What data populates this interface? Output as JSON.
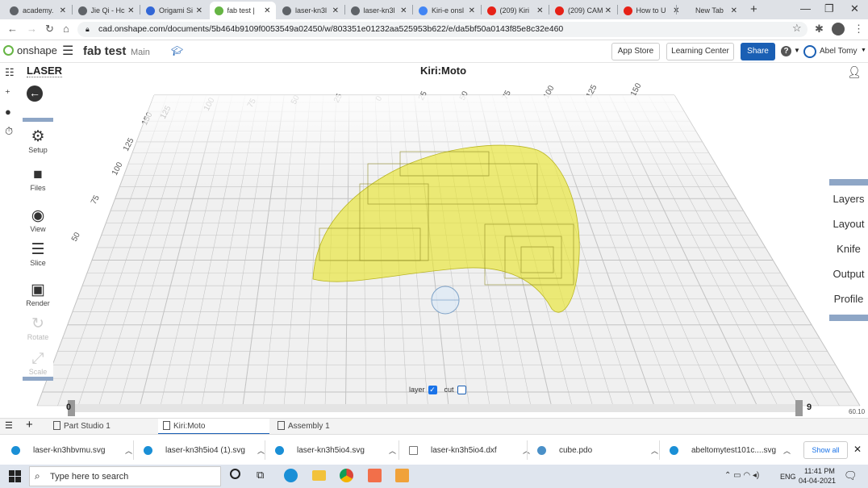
{
  "browser": {
    "tabs": [
      {
        "label": "academy.",
        "color": "#5f6368",
        "active": false
      },
      {
        "label": "Jie Qi - Hc",
        "color": "#5f6368",
        "active": false
      },
      {
        "label": "Origami Si",
        "color": "#3367d6",
        "active": false
      },
      {
        "label": "fab test | ",
        "color": "#66b544",
        "active": true
      },
      {
        "label": "laser-kn3l",
        "color": "#5f6368",
        "active": false
      },
      {
        "label": "laser-kn3l",
        "color": "#5f6368",
        "active": false
      },
      {
        "label": "Kiri-e onsl",
        "color": "#4285f4",
        "active": false
      },
      {
        "label": "(209) Kiri",
        "color": "#e62117",
        "active": false
      },
      {
        "label": "(209) CAM",
        "color": "#e62117",
        "active": false
      },
      {
        "label": "How to U",
        "color": "#e62117",
        "active": false
      },
      {
        "label": "New Tab",
        "color": "#dee1e6",
        "active": false
      }
    ],
    "new_tab_symbol": "+",
    "url": "cad.onshape.com/documents/5b464b9109f0053549a02450/w/803351e01232aa525953b622/e/da5bf50a0143f85e8c32e460"
  },
  "app": {
    "logo_text": "onshape",
    "doc_title": "fab test",
    "branch": "Main",
    "buttons": {
      "app_store": "App Store",
      "learning": "Learning Center",
      "share": "Share"
    },
    "user": "Abel Tomy"
  },
  "kiri": {
    "mode": "LASER",
    "title": "Kiri:Moto",
    "tools": [
      {
        "name": "setup",
        "label": "Setup",
        "icon": "⚙",
        "enabled": true
      },
      {
        "name": "files",
        "label": "Files",
        "icon": "■",
        "enabled": true
      },
      {
        "name": "view",
        "label": "View",
        "icon": "◉",
        "enabled": true
      },
      {
        "name": "slice",
        "label": "Slice",
        "icon": "☰",
        "enabled": true
      },
      {
        "name": "render",
        "label": "Render",
        "icon": "▣",
        "enabled": true
      },
      {
        "name": "rotate",
        "label": "Rotate",
        "icon": "↻",
        "enabled": false
      },
      {
        "name": "scale",
        "label": "Scale",
        "icon": "⤢",
        "enabled": false
      }
    ],
    "right_menu": [
      "Layers",
      "Layout",
      "Knife",
      "Output",
      "Profile"
    ],
    "grid_labels": [
      "50",
      "75",
      "100",
      "125",
      "150",
      "125",
      "100",
      "75",
      "50",
      "25",
      "0",
      "25",
      "50",
      "75",
      "100",
      "125",
      "150"
    ],
    "layer_label": "layer",
    "layer_checked": true,
    "cut_label": "cut",
    "cut_checked": false,
    "slider_min": "0",
    "slider_max": "9",
    "corner_value": "60.10",
    "accent": "#8ea6c6",
    "shape_color": "#e8e52a"
  },
  "bottom_tabs": [
    {
      "label": "Part Studio 1",
      "active": false
    },
    {
      "label": "Kiri:Moto",
      "active": true
    },
    {
      "label": "Assembly 1",
      "active": false
    }
  ],
  "downloads": [
    {
      "name": "laser-kn3hbvmu.svg",
      "icon": "edge-icon"
    },
    {
      "name": "laser-kn3h5io4 (1).svg",
      "icon": "edge-icon"
    },
    {
      "name": "laser-kn3h5io4.svg",
      "icon": "edge-icon"
    },
    {
      "name": "laser-kn3h5io4.dxf",
      "icon": "file-icon"
    },
    {
      "name": "cube.pdo",
      "icon": "pdo-icon"
    },
    {
      "name": "abeltomytest101c....svg",
      "icon": "edge-icon"
    }
  ],
  "downloads_show_all": "Show all",
  "taskbar": {
    "search_placeholder": "Type here to search",
    "lang": "ENG",
    "time": "11:41 PM",
    "date": "04-04-2021"
  }
}
